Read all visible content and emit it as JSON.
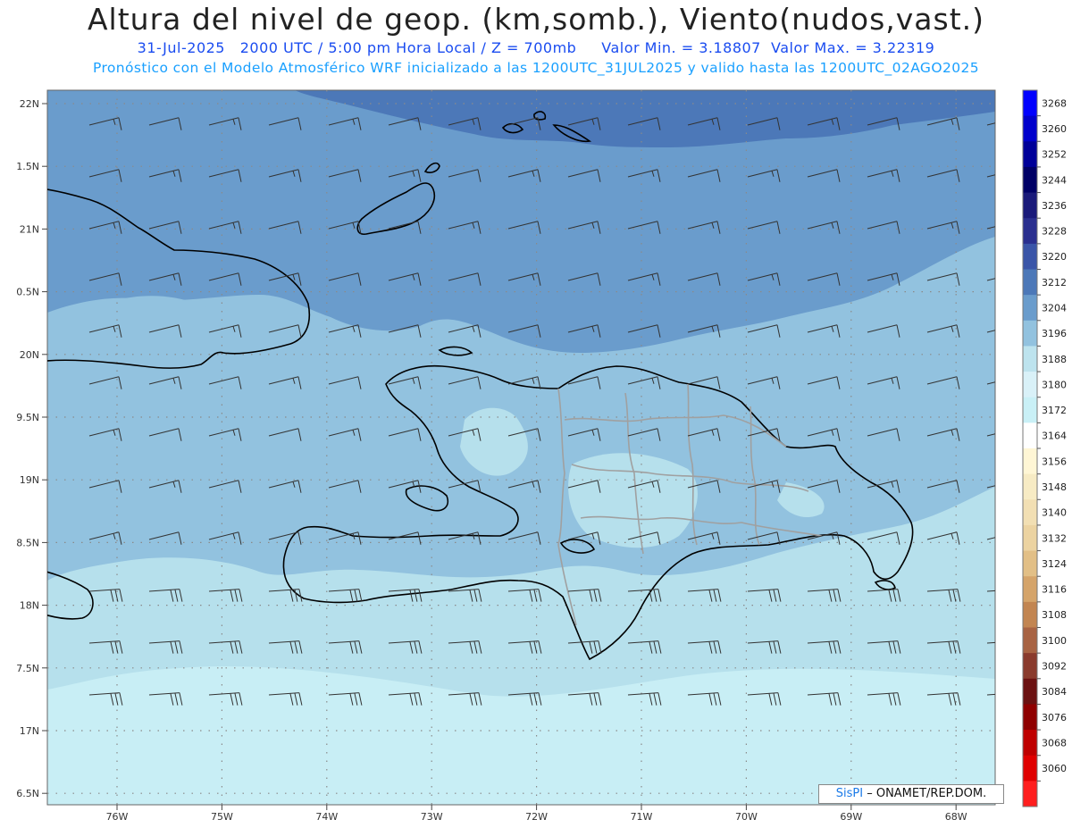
{
  "title": "Altura del nivel de geop. (km,somb.), Viento(nudos,vast.)",
  "subtitle_line": "31-Jul-2025   2000 UTC / 5:00 pm Hora Local / Z = 700mb     Valor Min. = 3.18807  Valor Max. = 3.22319",
  "model_line": "Pronóstico con el Modelo Atmosférico WRF inicializado a las 1200UTC_31JUL2025 y valido hasta las  1200UTC_02AGO2025",
  "lat_labels": [
    "22N",
    "1.5N",
    "21N",
    "0.5N",
    "20N",
    "9.5N",
    "19N",
    "8.5N",
    "18N",
    "7.5N",
    "17N",
    "6.5N"
  ],
  "lon_labels": [
    "76W",
    "75W",
    "74W",
    "73W",
    "72W",
    "71W",
    "70W",
    "69W",
    "68W"
  ],
  "colorbar": {
    "labels": [
      "3268",
      "3260",
      "3252",
      "3244",
      "3236",
      "3228",
      "3220",
      "3212",
      "3204",
      "3196",
      "3188",
      "3180",
      "3172",
      "3164",
      "3156",
      "3148",
      "3140",
      "3132",
      "3124",
      "3116",
      "3108",
      "3100",
      "3092",
      "3084",
      "3076",
      "3068",
      "3060"
    ],
    "colors": [
      "#0000ff",
      "#0000cc",
      "#000099",
      "#000066",
      "#1a1a7a",
      "#2a2f8f",
      "#3a55a8",
      "#4c78b8",
      "#6a9ccc",
      "#92c2df",
      "#bde3ee",
      "#d9f1f8",
      "#c9f0f6",
      "#ffffff",
      "#fff6d5",
      "#f7ebc4",
      "#f2dfb3",
      "#ecd3a1",
      "#e2bf86",
      "#d5a46a",
      "#c28551",
      "#a86343",
      "#8a3b2d",
      "#6b1111",
      "#8f0000",
      "#bf0000",
      "#e00000",
      "#ff1e1e"
    ]
  },
  "credit": {
    "brand": "SisPI",
    "text": "– ONAMET/REP.DOM."
  }
}
